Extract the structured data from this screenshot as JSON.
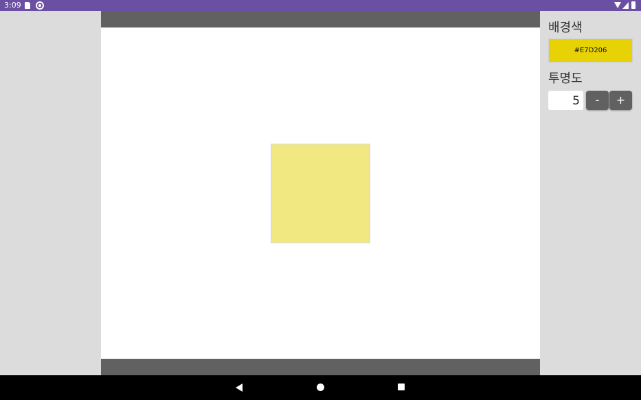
{
  "status_bar": {
    "time": "3:09",
    "icons": [
      "sd-card-icon",
      "sync-icon",
      "wifi-icon",
      "signal-icon",
      "battery-icon"
    ]
  },
  "canvas": {
    "box_color": "#E7D206",
    "box_opacity_level": 5
  },
  "panel": {
    "background_color_label": "배경색",
    "color_value": "#E7D206",
    "opacity_label": "투명도",
    "opacity_value": "5",
    "minus_label": "-",
    "plus_label": "+"
  },
  "colors": {
    "status_bar": "#6a4fa3",
    "panel_background": "#dcdcdc",
    "canvas_bar": "#616161",
    "canvas_background": "#ffffff",
    "button": "#616161"
  },
  "nav_bar": {
    "icons": [
      "back-icon",
      "home-icon",
      "recents-icon"
    ]
  }
}
